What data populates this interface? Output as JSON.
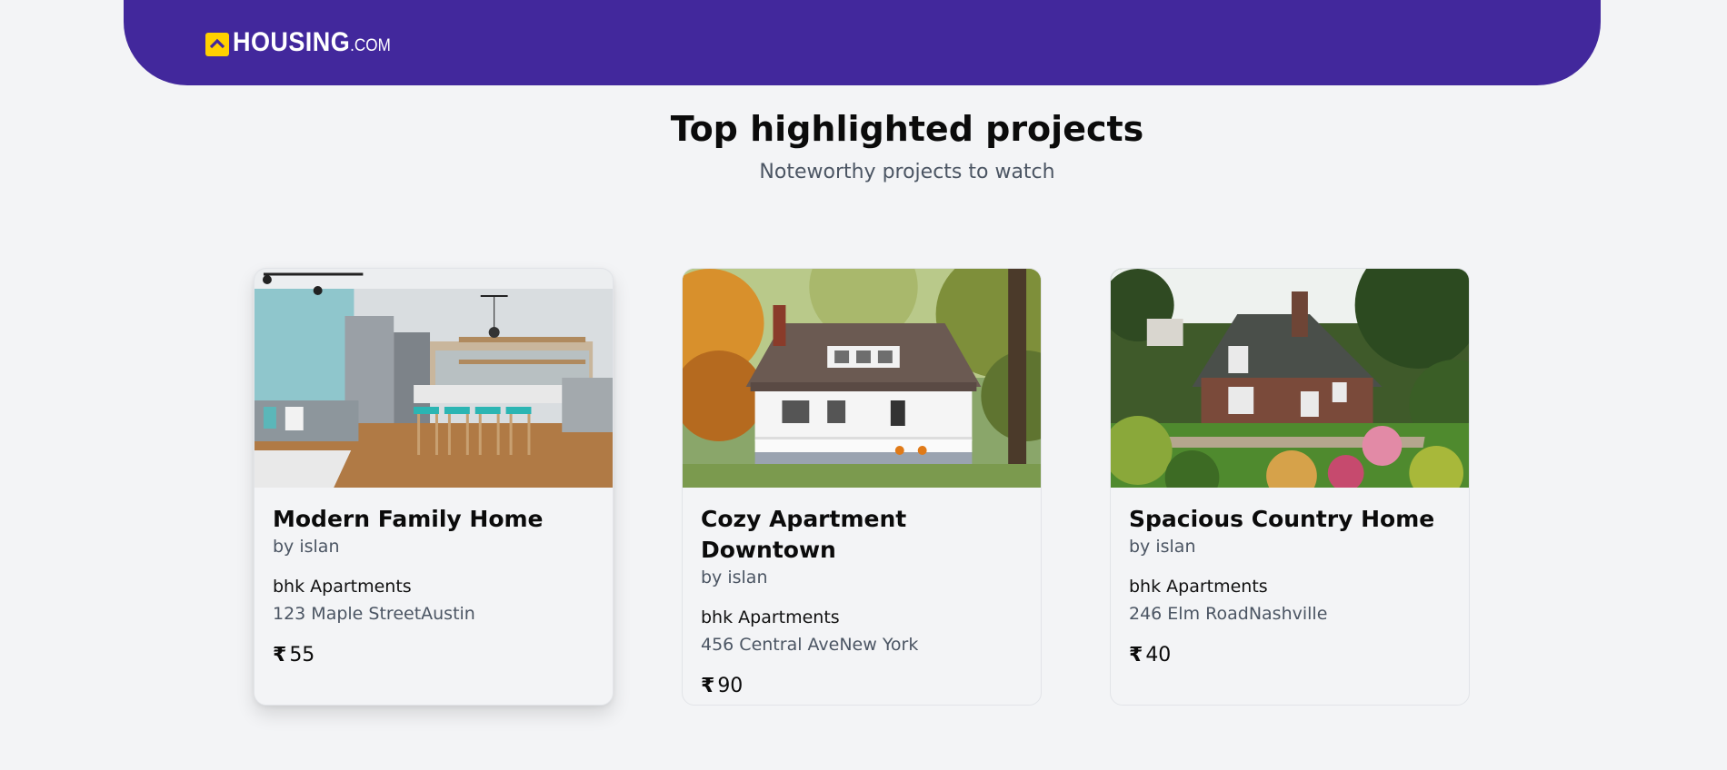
{
  "header": {
    "logo_main": "HOUSING",
    "logo_suffix": ".COM",
    "background": "#42289c",
    "logo_badge_color": "#ffd000"
  },
  "section": {
    "title": "Top highlighted projects",
    "subtitle": "Noteworthy projects to watch"
  },
  "currency_symbol": "₹",
  "projects": [
    {
      "title": "Modern Family Home",
      "by": "by islan",
      "type": "bhk Apartments",
      "address": "123 Maple StreetAustin",
      "price": "55",
      "image": "modern-kitchen-interior"
    },
    {
      "title": "Cozy Apartment Downtown",
      "by": "by islan",
      "type": "bhk Apartments",
      "address": "456 Central AveNew York",
      "price": "90",
      "image": "white-house-porch"
    },
    {
      "title": "Spacious Country Home",
      "by": "by islan",
      "type": "bhk Apartments",
      "address": "246 Elm RoadNashville",
      "price": "40",
      "image": "brick-cottage-garden"
    }
  ]
}
